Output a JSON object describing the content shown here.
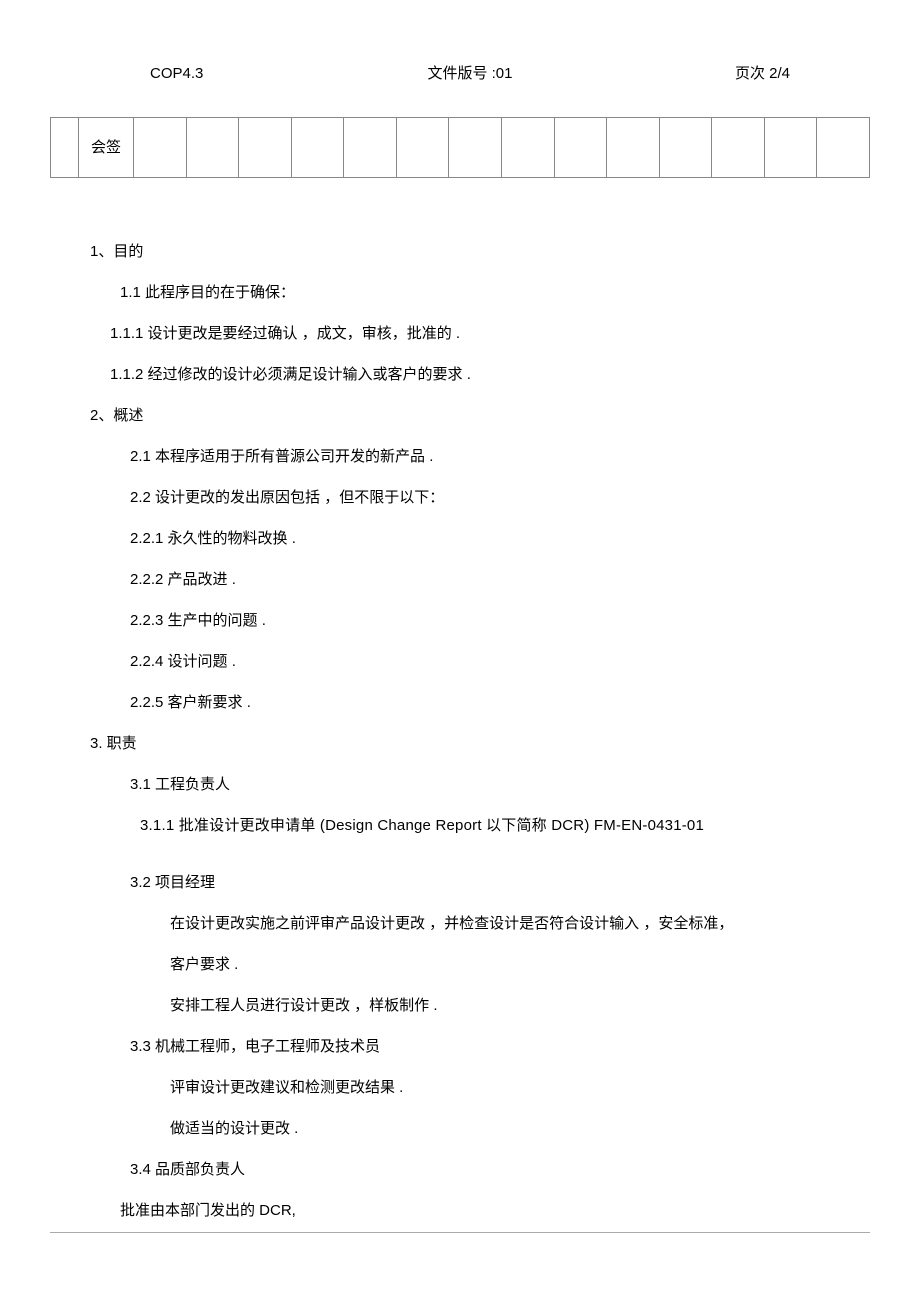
{
  "header": {
    "doc_code": "COP4.3",
    "version_label": "文件版号 :01",
    "page_label": "页次 2/4"
  },
  "sign_row_label": "会签",
  "sections": {
    "s1_title": "1、目的",
    "s1_1": "1.1  此程序目的在于确保：",
    "s1_1_1": "1.1.1      设计更改是要经过确认  ，成文，审核，批准的 .",
    "s1_1_2": "1.1.2      经过修改的设计必须满足设计输入或客户的要求    .",
    "s2_title": "2、概述",
    "s2_1": "2.1  本程序适用于所有普源公司开发的新产品    .",
    "s2_2": "2.2  设计更改的发出原因包括  ，但不限于以下：",
    "s2_2_1": "2.2.1  永久性的物料改换 .",
    "s2_2_2": "2.2.2  产品改进 .",
    "s2_2_3": "2.2.3  生产中的问题 .",
    "s2_2_4": "2.2.4  设计问题 .",
    "s2_2_5": "2.2.5  客户新要求 .",
    "s3_title": "3. 职责",
    "s3_1": "3.1  工程负责人",
    "s3_1_1": "3.1.1  批准设计更改申请单  (Design Change Report       以下简称 DCR) FM-EN-0431-01",
    "s3_2": "3.2 项目经理",
    "s3_2_body1": "在设计更改实施之前评审产品设计更改    ，并检查设计是否符合设计输入   ，安全标准，",
    "s3_2_body2": "客户要求 .",
    "s3_2_body3": "安排工程人员进行设计更改   ，样板制作 .",
    "s3_3": "3.3 机械工程师，电子工程师及技术员",
    "s3_3_body1": "评审设计更改建议和检测更改结果    .",
    "s3_3_body2": "做适当的设计更改  .",
    "s3_4": "3.4 品质部负责人",
    "s3_4_body1": "批准由本部门发出的    DCR,"
  }
}
